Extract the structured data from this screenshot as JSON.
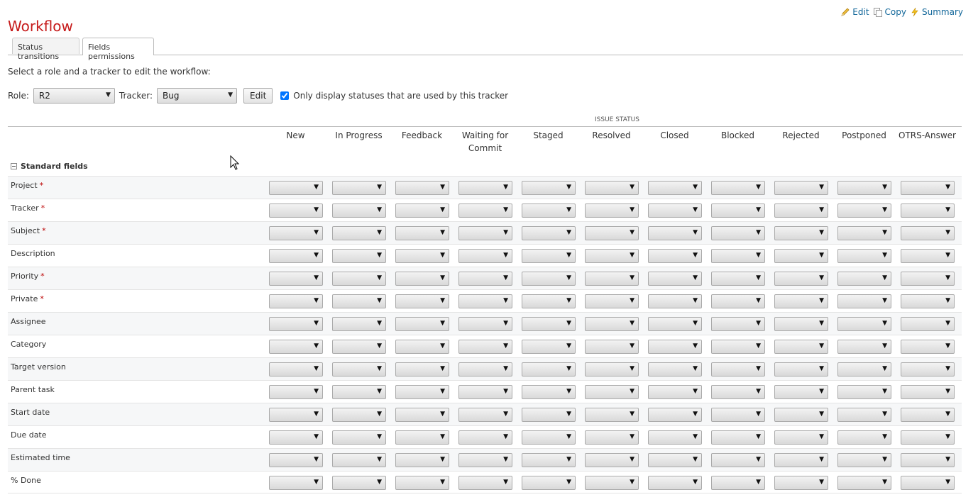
{
  "page": {
    "title": "Workflow"
  },
  "contextual": {
    "edit": "Edit",
    "copy": "Copy",
    "summary": "Summary"
  },
  "tabs": [
    {
      "label": "Status transitions",
      "selected": false
    },
    {
      "label": "Fields permissions",
      "selected": true
    }
  ],
  "instruction": "Select a role and a tracker to edit the workflow:",
  "filters": {
    "role_label": "Role:",
    "role_value": "R2",
    "tracker_label": "Tracker:",
    "tracker_value": "Bug",
    "edit_button": "Edit",
    "only_used_checked": true,
    "only_used_label": "Only display statuses that are used by this tracker"
  },
  "table": {
    "group_header": "ISSUE STATUS",
    "statuses": [
      "New",
      "In Progress",
      "Feedback",
      "Waiting for Commit",
      "Staged",
      "Resolved",
      "Closed",
      "Blocked",
      "Rejected",
      "Postponed",
      "OTRS-Answer"
    ],
    "section": "Standard fields",
    "rows": [
      {
        "label": "Project",
        "required": true
      },
      {
        "label": "Tracker",
        "required": true
      },
      {
        "label": "Subject",
        "required": true
      },
      {
        "label": "Description",
        "required": false
      },
      {
        "label": "Priority",
        "required": true
      },
      {
        "label": "Private",
        "required": true
      },
      {
        "label": "Assignee",
        "required": false
      },
      {
        "label": "Category",
        "required": false
      },
      {
        "label": "Target version",
        "required": false
      },
      {
        "label": "Parent task",
        "required": false
      },
      {
        "label": "Start date",
        "required": false
      },
      {
        "label": "Due date",
        "required": false
      },
      {
        "label": "Estimated time",
        "required": false
      },
      {
        "label": "% Done",
        "required": false
      }
    ],
    "cell_value": ""
  },
  "colors": {
    "title": "#c61a1a",
    "link": "#116699",
    "required": "#bb0000"
  },
  "icons": {
    "edit": "pencil-icon",
    "copy": "copy-icon",
    "summary": "lightning-icon",
    "collapse": "collapse-icon",
    "pointer": "mouse-cursor-icon"
  }
}
